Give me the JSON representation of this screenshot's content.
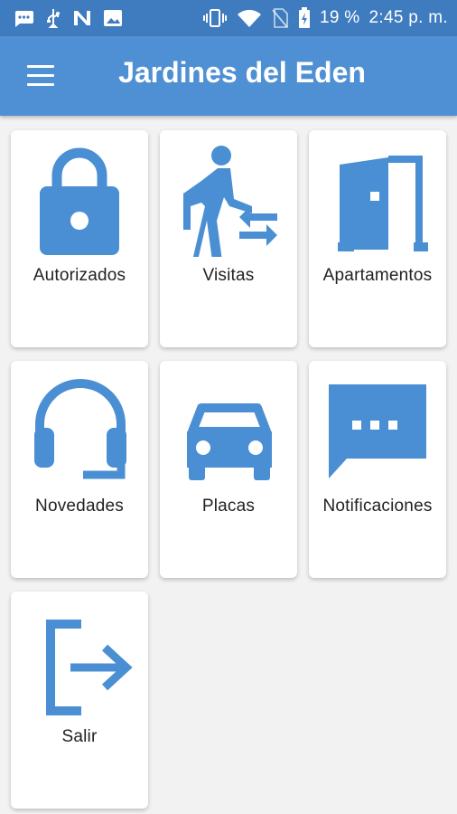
{
  "status_bar": {
    "battery_percent": "19 %",
    "time": "2:45 p. m.",
    "icons": [
      "chat-icon",
      "usb-icon",
      "n-icon",
      "image-icon",
      "vibrate-icon",
      "wifi-icon",
      "no-sim-icon",
      "battery-icon"
    ]
  },
  "app_bar": {
    "title": "Jardines del Eden",
    "menu_icon": "menu-icon"
  },
  "accent_color": "#4a8fd3",
  "tiles": [
    {
      "label": "Autorizados",
      "icon": "lock-icon"
    },
    {
      "label": "Visitas",
      "icon": "visitor-walk-icon"
    },
    {
      "label": "Apartamentos",
      "icon": "door-icon"
    },
    {
      "label": "Novedades",
      "icon": "headset-icon"
    },
    {
      "label": "Placas",
      "icon": "car-icon"
    },
    {
      "label": "Notificaciones",
      "icon": "message-icon"
    },
    {
      "label": "Salir",
      "icon": "exit-icon"
    }
  ]
}
